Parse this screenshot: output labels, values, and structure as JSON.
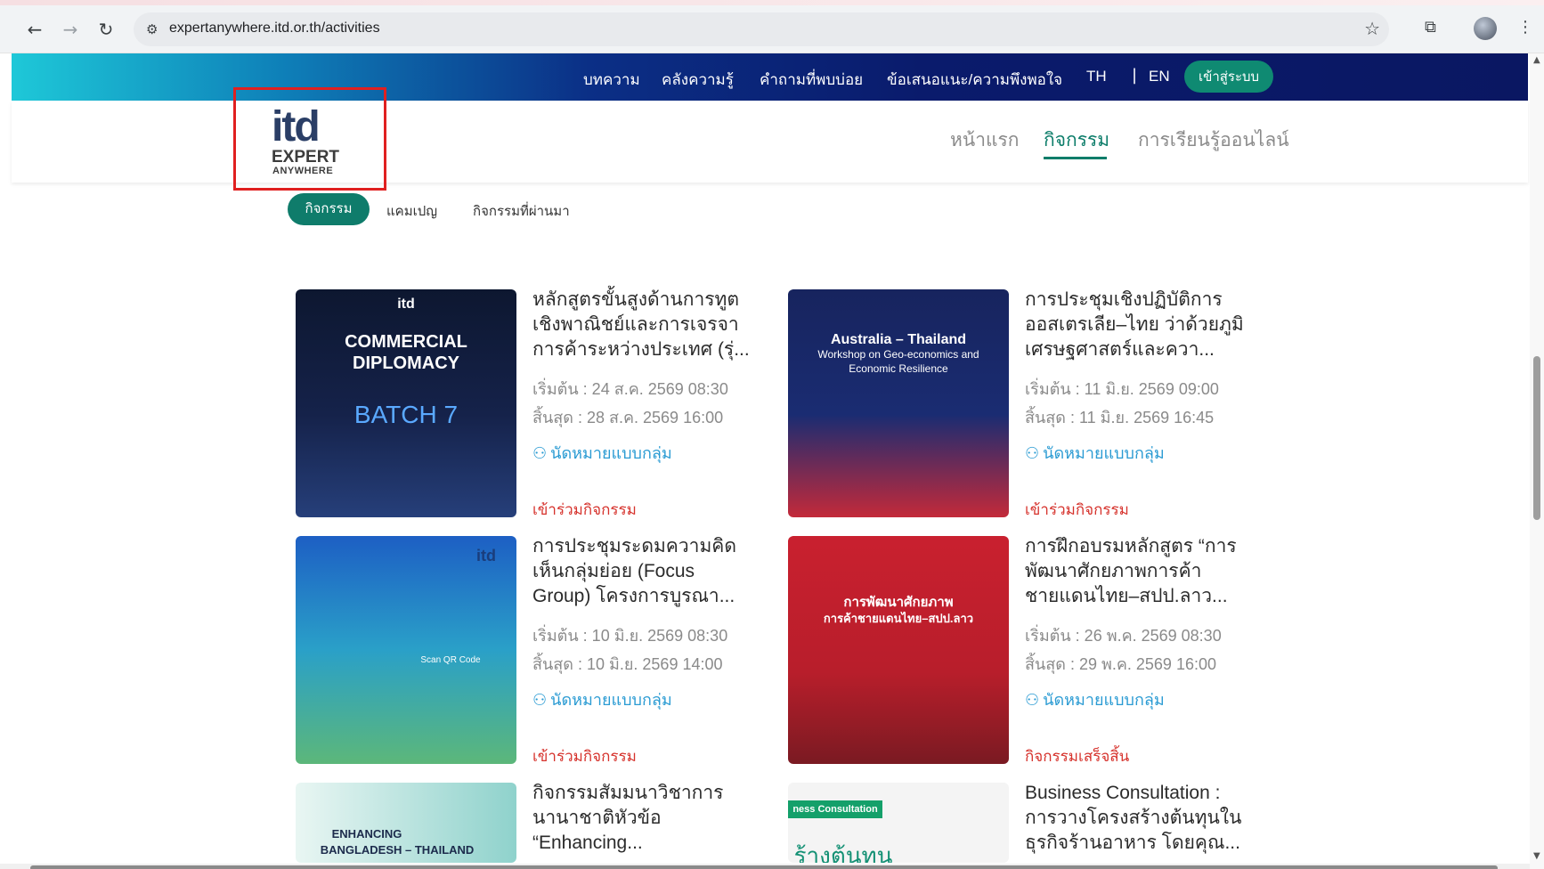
{
  "browser": {
    "url": "expertanywhere.itd.or.th/activities"
  },
  "topnav": {
    "items": [
      "บทความ",
      "คลังความรู้",
      "คำถามที่พบบ่อย",
      "ข้อเสนอแนะ/ความพึงพอใจ"
    ],
    "lang_th": "TH",
    "lang_sep": "|",
    "lang_en": "EN",
    "login": "เข้าสู่ระบบ"
  },
  "logo": {
    "itd": "itd",
    "expert": "EXPERT",
    "anywhere": "ANYWHERE"
  },
  "mainnav": {
    "home": "หน้าแรก",
    "activities": "กิจกรรม",
    "online": "การเรียนรู้ออนไลน์"
  },
  "subtabs": [
    "กิจกรรม",
    "แคมเปญ",
    "กิจกรรมที่ผ่านมา"
  ],
  "cards": [
    {
      "title": "หลักสูตรขั้นสูงด้านการทูตเชิงพาณิชย์และการเจรจาการค้าระหว่างประเทศ (รุ่...",
      "start": "เริ่มต้น : 24 ส.ค. 2569 08:30",
      "end": "สิ้นสุด : 28 ส.ค. 2569 16:00",
      "type": "นัดหมายแบบกลุ่ม",
      "action": "เข้าร่วมกิจกรรม",
      "thumb_lines": [
        "itd",
        "COMMERCIAL",
        "DIPLOMACY",
        "BATCH 7"
      ]
    },
    {
      "title": "การประชุมเชิงปฏิบัติการออสเตรเลีย–ไทย ว่าด้วยภูมิเศรษฐศาสตร์และควา...",
      "start": "เริ่มต้น : 11 มิ.ย. 2569 09:00",
      "end": "สิ้นสุด : 11 มิ.ย. 2569 16:45",
      "type": "นัดหมายแบบกลุ่ม",
      "action": "เข้าร่วมกิจกรรม",
      "thumb_lines": [
        "Australia – Thailand",
        "Workshop on Geo-economics and",
        "Economic Resilience"
      ]
    },
    {
      "title": "การประชุมระดมความคิดเห็นกลุ่มย่อย (Focus Group) โครงการบูรณา...",
      "start": "เริ่มต้น : 10 มิ.ย. 2569 08:30",
      "end": "สิ้นสุด : 10 มิ.ย. 2569 14:00",
      "type": "นัดหมายแบบกลุ่ม",
      "action": "เข้าร่วมกิจกรรม",
      "thumb_lines": [
        "itd",
        "Scan QR Code"
      ]
    },
    {
      "title": "การฝึกอบรมหลักสูตร “การพัฒนาศักยภาพการค้าชายแดนไทย–สปป.ลาว...",
      "start": "เริ่มต้น : 26 พ.ค. 2569 08:30",
      "end": "สิ้นสุด : 29 พ.ค. 2569 16:00",
      "type": "นัดหมายแบบกลุ่ม",
      "action": "กิจกรรมเสร็จสิ้น",
      "thumb_lines": [
        "การพัฒนาศักยภาพ",
        "การค้าชายแดนไทย–สปป.ลาว"
      ]
    },
    {
      "title": "กิจกรรมสัมมนาวิชาการนานาชาติหัวข้อ “Enhancing...",
      "thumb_lines": [
        "ENHANCING",
        "BANGLADESH – THAILAND"
      ]
    },
    {
      "title": "Business Consultation : การวางโครงสร้างต้นทุนในธุรกิจร้านอาหาร โดยคุณ...",
      "thumb_lines": [
        "ness Consultation",
        "ร้างต้นทุน"
      ]
    }
  ],
  "colors": {
    "brand_green": "#0f7c6b",
    "action_red": "#d6322c",
    "type_blue": "#2a9bd3",
    "nav_dark": "#0a1762"
  }
}
